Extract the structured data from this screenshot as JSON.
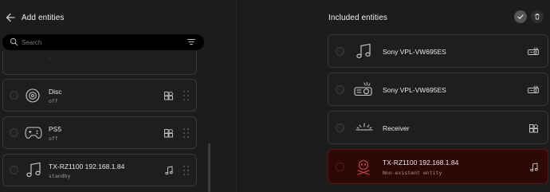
{
  "left": {
    "title": "Add entities",
    "search_placeholder": "Search",
    "items": [
      {
        "name": "",
        "status": "",
        "icon": "partial-item"
      },
      {
        "name": "Disc",
        "status": "off",
        "icon": "disc-icon",
        "type_icon": "media-player-icon"
      },
      {
        "name": "PS5",
        "status": "off",
        "icon": "gamepad-icon",
        "type_icon": "media-player-icon"
      },
      {
        "name": "TX-RZ1100 192.168.1.84",
        "status": "standby",
        "icon": "music-note-icon",
        "type_icon": "music-note-icon"
      }
    ]
  },
  "right": {
    "title": "Included entities",
    "items": [
      {
        "name": "Sony VPL-VW695ES",
        "status": "",
        "icon": "music-note-icon",
        "type_icon": "projector-icon"
      },
      {
        "name": "Sony VPL-VW695ES",
        "status": "",
        "icon": "projector-icon",
        "type_icon": "projector-icon"
      },
      {
        "name": "Receiver",
        "status": "",
        "icon": "receiver-icon",
        "type_icon": "media-player-icon"
      },
      {
        "name": "TX-RZ1100 192.168.1.84",
        "status": "Non-existent entity",
        "icon": "skull-icon",
        "type_icon": "music-note-icon",
        "error": true
      }
    ]
  },
  "colors": {
    "background": "#1c1c1c",
    "card_border": "#3a3a3a",
    "error_background": "#2e0707",
    "error_icon": "#d04848"
  }
}
